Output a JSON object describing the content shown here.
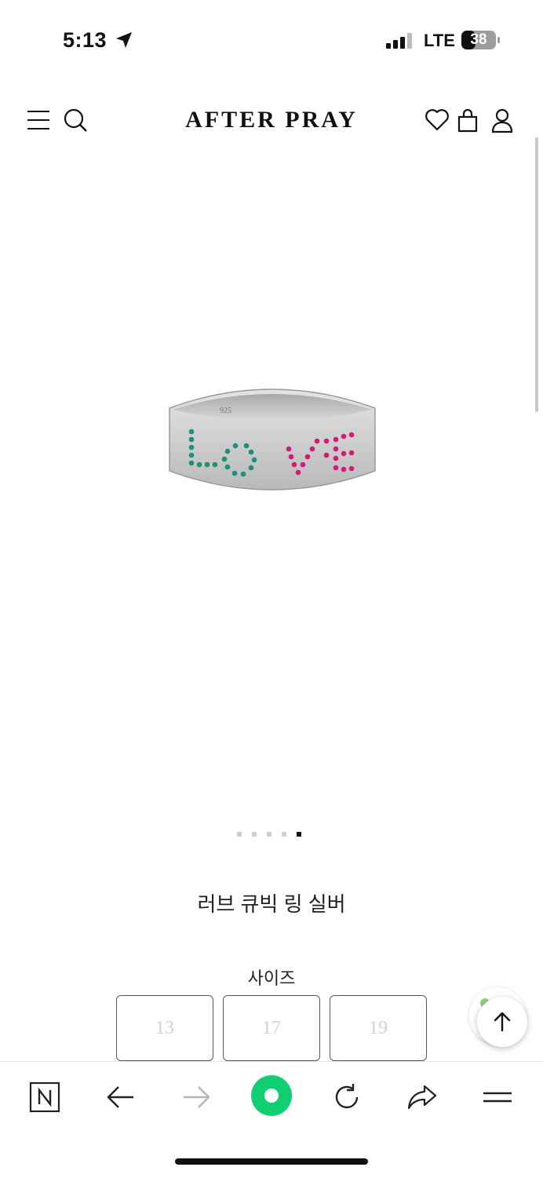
{
  "status_bar": {
    "time": "5:13",
    "network": "LTE",
    "battery": "38"
  },
  "header": {
    "brand": "AFTER PRAY",
    "icons": [
      "menu-icon",
      "search-icon",
      "heart-icon",
      "bag-icon",
      "user-icon"
    ]
  },
  "product": {
    "image_engraving": "925",
    "image_text": "LOVE",
    "carousel": {
      "count": 5,
      "active_index": 4
    },
    "title": "러브 큐빅 링 실버",
    "size_label": "사이즈",
    "sizes": [
      "13",
      "17",
      "19"
    ]
  },
  "colors": {
    "green_stone": "#1e8f78",
    "pink_stone": "#d4197a",
    "silver": "#c9c9c9"
  },
  "toolbar": {
    "icons": [
      "naver-n-icon",
      "back-arrow-icon",
      "forward-arrow-icon",
      "green-dot-icon",
      "refresh-icon",
      "share-icon",
      "menu-lines-icon"
    ]
  }
}
